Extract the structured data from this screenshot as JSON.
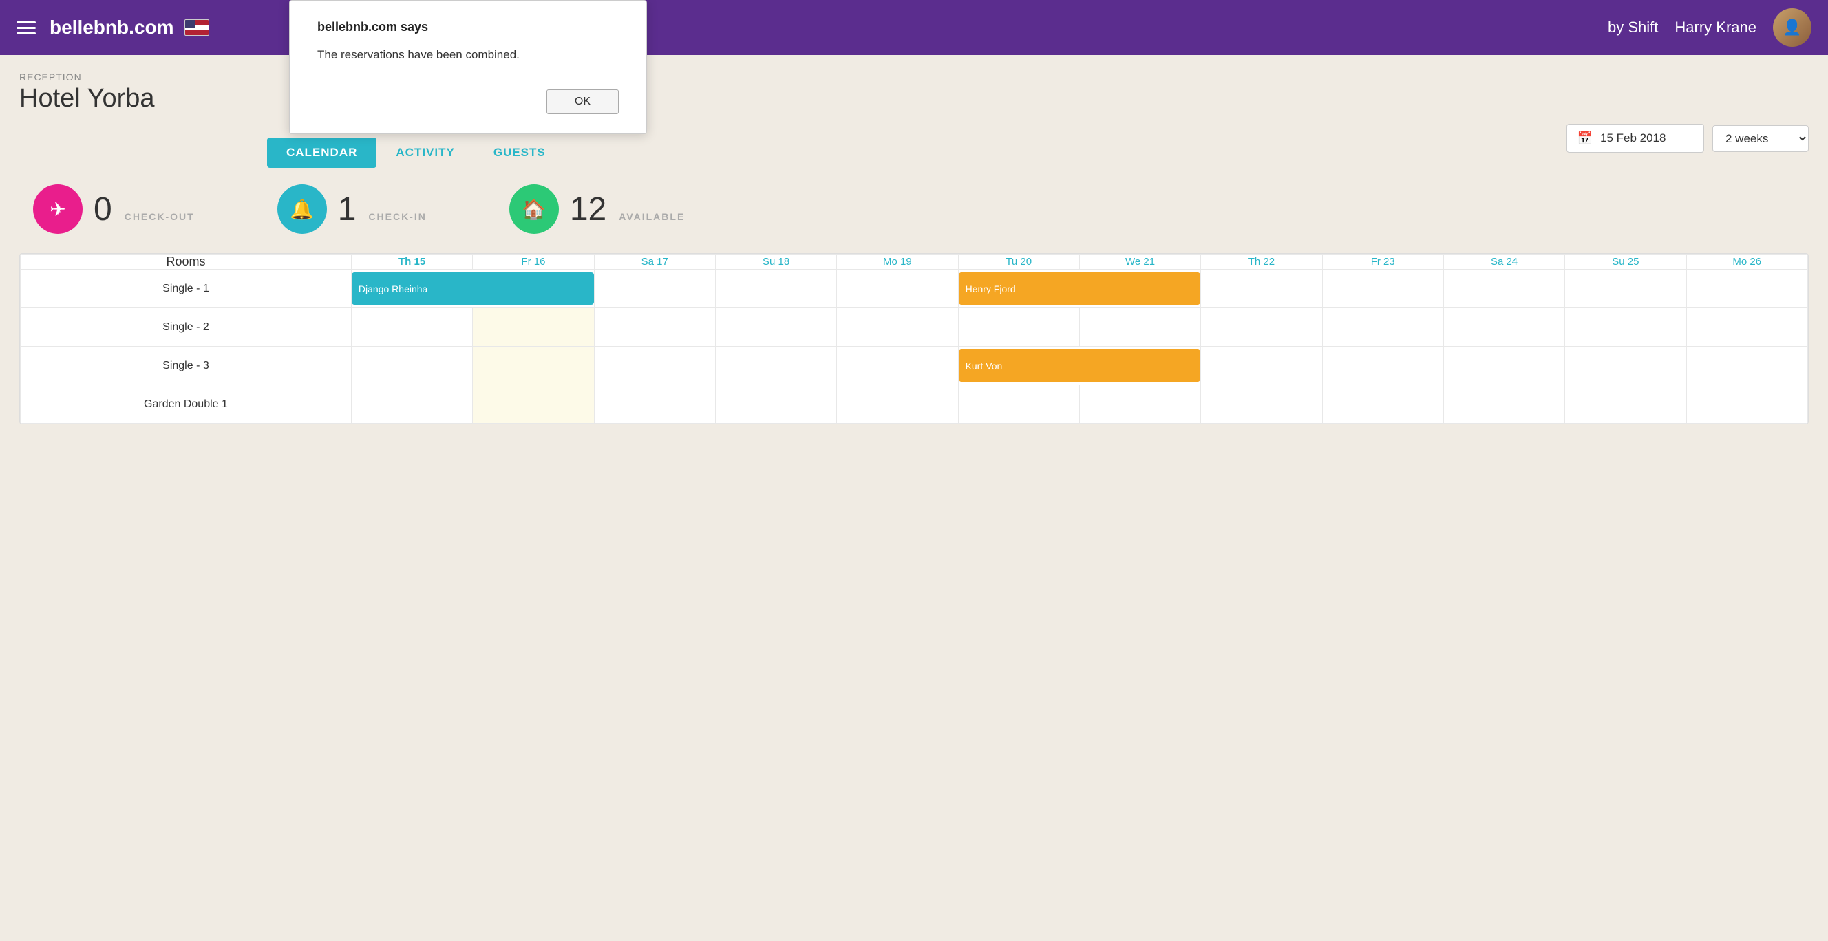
{
  "header": {
    "logo": "bellebnb.com",
    "shift_label": "by Shift",
    "username": "Harry Krane"
  },
  "dialog": {
    "title": "bellebnb.com says",
    "message": "The reservations have been combined.",
    "ok_label": "OK"
  },
  "reception": {
    "label": "RECEPTION",
    "hotel_name": "Hotel Yorba"
  },
  "date_controls": {
    "date": "15 Feb 2018",
    "weeks": "2 weeks"
  },
  "tabs": [
    {
      "label": "CALENDAR",
      "active": true
    },
    {
      "label": "ACTIVITY",
      "active": false
    },
    {
      "label": "GUESTS",
      "active": false
    }
  ],
  "stats": [
    {
      "count": "0",
      "label": "CHECK-OUT",
      "icon": "✈",
      "color": "pink"
    },
    {
      "count": "1",
      "label": "CHECK-IN",
      "icon": "◉",
      "color": "blue"
    },
    {
      "count": "12",
      "label": "AVAILABLE",
      "icon": "⌂",
      "color": "green"
    }
  ],
  "calendar": {
    "rooms_header": "Rooms",
    "days": [
      {
        "label": "Th 15",
        "today": true
      },
      {
        "label": "Fr 16",
        "today": false
      },
      {
        "label": "Sa 17",
        "today": false
      },
      {
        "label": "Su 18",
        "today": false
      },
      {
        "label": "Mo 19",
        "today": false
      },
      {
        "label": "Tu 20",
        "today": false
      },
      {
        "label": "We 21",
        "today": false
      },
      {
        "label": "Th 22",
        "today": false
      },
      {
        "label": "Fr 23",
        "today": false
      },
      {
        "label": "Sa 24",
        "today": false
      },
      {
        "label": "Su 25",
        "today": false
      },
      {
        "label": "Mo 26",
        "today": false
      }
    ],
    "rows": [
      {
        "room": "Single - 1",
        "bookings": [
          {
            "col_start": 0,
            "col_span": 2,
            "name": "Django Rheinha",
            "color": "cyan"
          },
          {
            "col_start": 5,
            "col_span": 2,
            "name": "Henry Fjord",
            "color": "orange"
          }
        ]
      },
      {
        "room": "Single - 2",
        "bookings": [
          {
            "col_start": 1,
            "col_span": 1,
            "name": "",
            "color": "yellow"
          }
        ]
      },
      {
        "room": "Single - 3",
        "bookings": [
          {
            "col_start": 1,
            "col_span": 1,
            "name": "",
            "color": "yellow"
          },
          {
            "col_start": 5,
            "col_span": 2,
            "name": "Kurt Von",
            "color": "orange"
          }
        ]
      },
      {
        "room": "Garden Double 1",
        "bookings": [
          {
            "col_start": 1,
            "col_span": 1,
            "name": "",
            "color": "yellow"
          }
        ]
      }
    ]
  }
}
